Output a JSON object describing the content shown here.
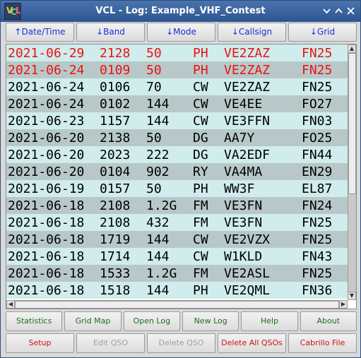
{
  "window": {
    "title": "VCL - Log:  Example_VHF_Contest",
    "icon_letters": [
      "V",
      "C",
      "L"
    ]
  },
  "titlebar_buttons": [
    "minimize-icon",
    "maximize-icon",
    "close-icon"
  ],
  "columns": [
    "↑Date/Time",
    "↓Band",
    "↓Mode",
    "↓Callsign",
    "↓Grid"
  ],
  "colors": {
    "row_teal": "#d0ecec",
    "row_gray": "#b8c8c8",
    "highlight_red": "#ee1111",
    "header_text": "#1a2fd0",
    "button_green": "#1e6e1e",
    "button_red": "#cc1111"
  },
  "rows": [
    {
      "date": "2021-06-29",
      "time": "2128",
      "band": "50",
      "mode": "PH",
      "call": "VE2ZAZ",
      "grid": "FN25",
      "red": true
    },
    {
      "date": "2021-06-24",
      "time": "0109",
      "band": "50",
      "mode": "PH",
      "call": "VE2ZAZ",
      "grid": "FN25",
      "red": true
    },
    {
      "date": "2021-06-24",
      "time": "0106",
      "band": "70",
      "mode": "CW",
      "call": "VE2ZAZ",
      "grid": "FN25",
      "red": false
    },
    {
      "date": "2021-06-24",
      "time": "0102",
      "band": "144",
      "mode": "CW",
      "call": "VE4EE",
      "grid": "FO27",
      "red": false
    },
    {
      "date": "2021-06-23",
      "time": "1157",
      "band": "144",
      "mode": "CW",
      "call": "VE3FFN",
      "grid": "FN03",
      "red": false
    },
    {
      "date": "2021-06-20",
      "time": "2138",
      "band": "50",
      "mode": "DG",
      "call": "AA7Y",
      "grid": "FO25",
      "red": false
    },
    {
      "date": "2021-06-20",
      "time": "2023",
      "band": "222",
      "mode": "DG",
      "call": "VA2EDF",
      "grid": "FN44",
      "red": false
    },
    {
      "date": "2021-06-20",
      "time": "0104",
      "band": "902",
      "mode": "RY",
      "call": "VA4MA",
      "grid": "EN29",
      "red": false
    },
    {
      "date": "2021-06-19",
      "time": "0157",
      "band": "50",
      "mode": "PH",
      "call": "WW3F",
      "grid": "EL87",
      "red": false
    },
    {
      "date": "2021-06-18",
      "time": "2108",
      "band": "1.2G",
      "mode": "FM",
      "call": "VE3FN",
      "grid": "FN24",
      "red": false
    },
    {
      "date": "2021-06-18",
      "time": "2108",
      "band": "432",
      "mode": "FM",
      "call": "VE3FN",
      "grid": "FN25",
      "red": false
    },
    {
      "date": "2021-06-18",
      "time": "1719",
      "band": "144",
      "mode": "CW",
      "call": "VE2VZX",
      "grid": "FN25",
      "red": false
    },
    {
      "date": "2021-06-18",
      "time": "1714",
      "band": "144",
      "mode": "CW",
      "call": "W1KLD",
      "grid": "FN43",
      "red": false
    },
    {
      "date": "2021-06-18",
      "time": "1533",
      "band": "1.2G",
      "mode": "FM",
      "call": "VE2ASL",
      "grid": "FN25",
      "red": false
    },
    {
      "date": "2021-06-18",
      "time": "1518",
      "band": "144",
      "mode": "PH",
      "call": "VE2QML",
      "grid": "FN36",
      "red": false
    }
  ],
  "buttons_row1": [
    {
      "label": "Statistics",
      "style": "green"
    },
    {
      "label": "Grid Map",
      "style": "green"
    },
    {
      "label": "Open Log",
      "style": "green"
    },
    {
      "label": "New Log",
      "style": "green"
    },
    {
      "label": "Help",
      "style": "green"
    },
    {
      "label": "About",
      "style": "green"
    }
  ],
  "buttons_row2": [
    {
      "label": "Setup",
      "style": "red"
    },
    {
      "label": "Edit QSO",
      "style": "disabled"
    },
    {
      "label": "Delete QSO",
      "style": "disabled"
    },
    {
      "label": "Delete All QSOs",
      "style": "red"
    },
    {
      "label": "Cabrillo File",
      "style": "red"
    }
  ],
  "scroll_arrows": {
    "up": "▲",
    "down": "▼",
    "left": "◀",
    "right": "▶"
  }
}
